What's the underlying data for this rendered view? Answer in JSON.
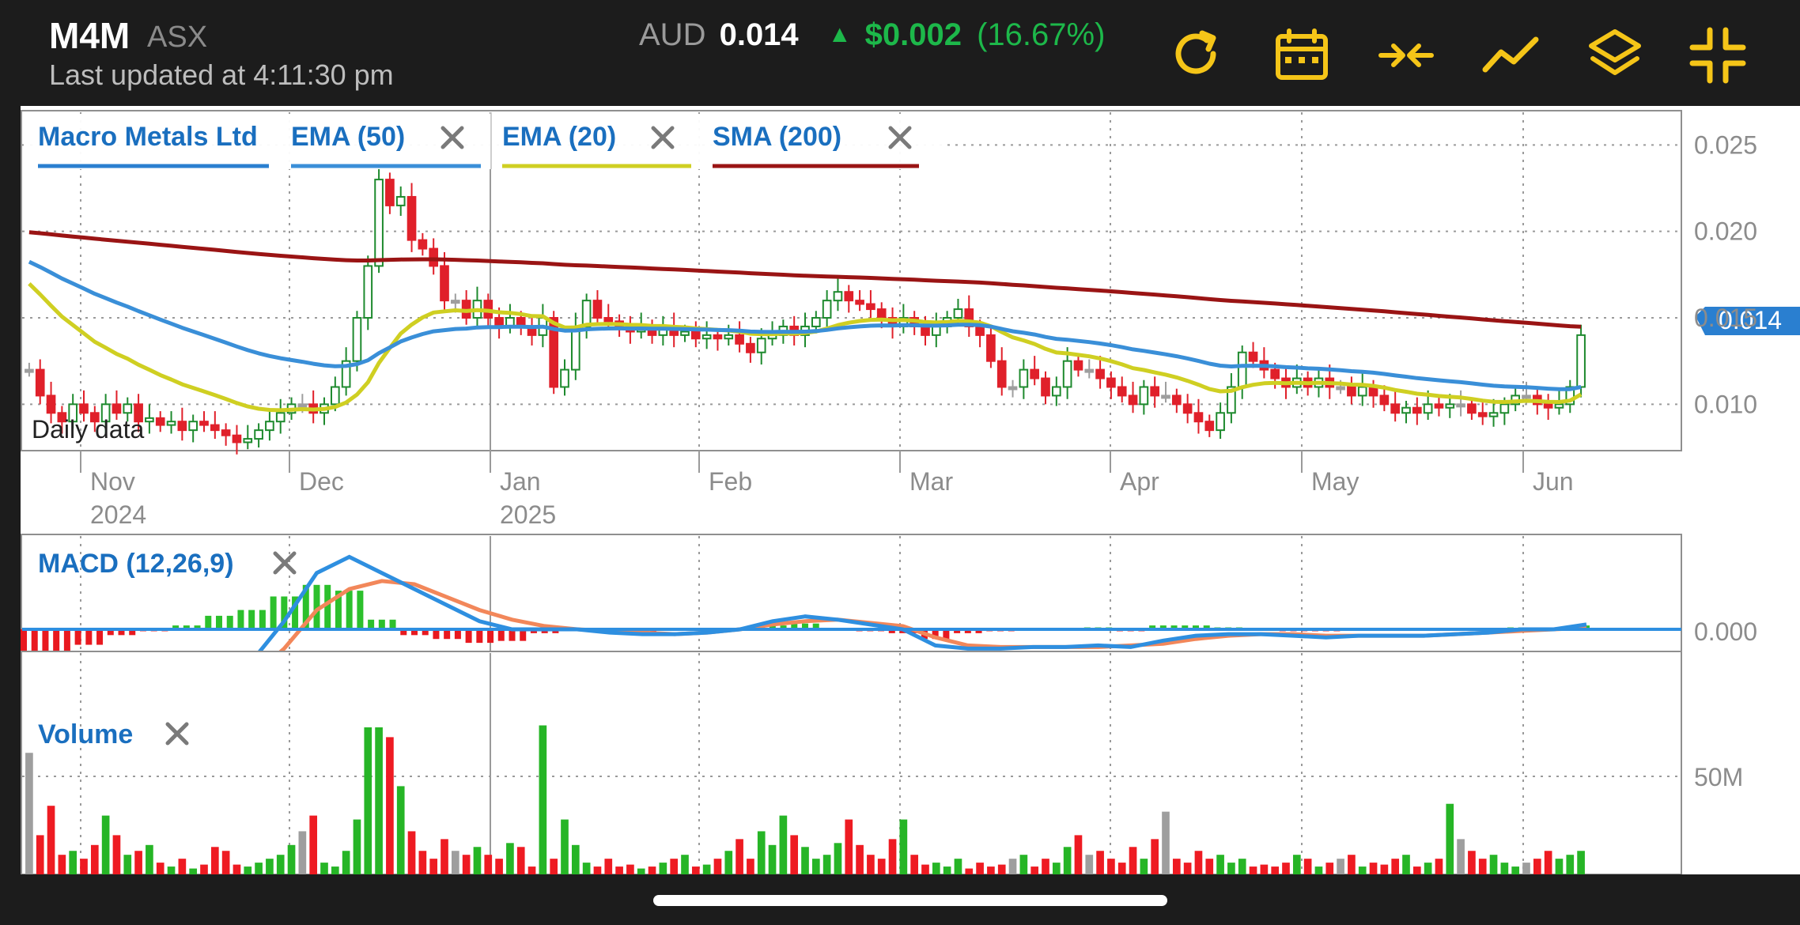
{
  "header": {
    "ticker": "M4M",
    "exchange": "ASX",
    "last_updated": "Last updated at 4:11:30 pm",
    "currency": "AUD",
    "last_price": "0.014",
    "change_abs": "$0.002",
    "change_pct": "(16.67%)",
    "change_direction": "up",
    "toolbar_icons": [
      "refresh-icon",
      "calendar-icon",
      "compress-icon",
      "trend-line-icon",
      "layers-icon",
      "exit-fullscreen-icon"
    ],
    "accent_color": "#f5c518"
  },
  "legend": {
    "main": [
      "Macro Metals Ltd",
      "EMA (50)",
      "EMA (20)",
      "SMA (200)"
    ],
    "macd": "MACD (12,26,9)",
    "volume": "Volume",
    "daily_data": "Daily data"
  },
  "chart_data": [
    {
      "type": "candlestick",
      "title": "Macro Metals Ltd",
      "ylim": [
        0.0075,
        0.0268
      ],
      "y_ticks": [
        "0.025",
        "0.020",
        "0.015",
        "0.010"
      ],
      "x_ticks": [
        {
          "label": "Nov",
          "sub": "2024",
          "pos": 0
        },
        {
          "label": "Dec",
          "sub": "",
          "pos": 1
        },
        {
          "label": "Jan",
          "sub": "2025",
          "pos": 2
        },
        {
          "label": "Feb",
          "sub": "",
          "pos": 3
        },
        {
          "label": "Mar",
          "sub": "",
          "pos": 4
        },
        {
          "label": "Apr",
          "sub": "",
          "pos": 5
        },
        {
          "label": "May",
          "sub": "",
          "pos": 6
        },
        {
          "label": "Jun",
          "sub": "",
          "pos": 7
        }
      ],
      "last_price_label": "0.014",
      "grid": true,
      "colors": {
        "up": "#1e8a2e",
        "down": "#e0202a",
        "flat": "#9e9e9e",
        "ema50": "#3a8fd8",
        "ema20": "#cfcf22",
        "sma200": "#9a1414"
      },
      "close": [
        0.012,
        0.0105,
        0.0095,
        0.009,
        0.01,
        0.0095,
        0.009,
        0.01,
        0.0095,
        0.01,
        0.009,
        0.0092,
        0.0088,
        0.009,
        0.0085,
        0.009,
        0.0088,
        0.0085,
        0.0082,
        0.0078,
        0.008,
        0.0085,
        0.009,
        0.0095,
        0.01,
        0.01,
        0.0095,
        0.01,
        0.011,
        0.0125,
        0.015,
        0.018,
        0.023,
        0.0215,
        0.022,
        0.0195,
        0.019,
        0.018,
        0.016,
        0.016,
        0.015,
        0.016,
        0.015,
        0.0145,
        0.015,
        0.0145,
        0.014,
        0.015,
        0.011,
        0.012,
        0.0145,
        0.016,
        0.015,
        0.0148,
        0.0145,
        0.0142,
        0.0145,
        0.014,
        0.0145,
        0.014,
        0.0142,
        0.0138,
        0.014,
        0.0138,
        0.014,
        0.0135,
        0.013,
        0.0138,
        0.014,
        0.0145,
        0.014,
        0.0145,
        0.015,
        0.016,
        0.0165,
        0.016,
        0.0158,
        0.0155,
        0.015,
        0.0145,
        0.015,
        0.0145,
        0.014,
        0.0145,
        0.015,
        0.0155,
        0.0145,
        0.014,
        0.0125,
        0.011,
        0.011,
        0.012,
        0.0115,
        0.0105,
        0.011,
        0.0125,
        0.012,
        0.012,
        0.0115,
        0.011,
        0.0105,
        0.01,
        0.011,
        0.0105,
        0.0105,
        0.01,
        0.0095,
        0.009,
        0.0085,
        0.0095,
        0.011,
        0.013,
        0.0125,
        0.012,
        0.0115,
        0.011,
        0.0115,
        0.011,
        0.0115,
        0.011,
        0.011,
        0.0105,
        0.011,
        0.0105,
        0.01,
        0.0095,
        0.0098,
        0.0095,
        0.01,
        0.0098,
        0.01,
        0.01,
        0.0095,
        0.0093,
        0.0095,
        0.01,
        0.0105,
        0.0105,
        0.01,
        0.0098,
        0.01,
        0.011,
        0.014
      ]
    },
    {
      "type": "line",
      "title": "MACD (12,26,9)",
      "y_ticks": [
        "0.000"
      ],
      "series": [
        {
          "name": "MACD",
          "color": "#2e8fe0",
          "values": [
            -0.0003,
            -0.00045,
            -0.0005,
            -0.00048,
            -0.00045,
            -0.0004,
            -0.0003,
            -0.0002,
            5e-05,
            0.00035,
            0.00045,
            0.00035,
            0.00025,
            0.00015,
            5e-05,
            0.0,
            0.0,
            0.0,
            -2e-05,
            -3e-05,
            -3e-05,
            -2e-05,
            0.0,
            5e-05,
            8e-05,
            6e-05,
            3e-05,
            0.0,
            -0.0001,
            -0.00012,
            -0.00012,
            -0.00011,
            -0.00011,
            -0.0001,
            -0.00011,
            -7e-05,
            -4e-05,
            -3e-05,
            -3e-05,
            -4e-05,
            -5e-05,
            -4e-05,
            -4e-05,
            -4e-05,
            -3e-05,
            -2e-05,
            0.0,
            0.0,
            3e-05
          ]
        },
        {
          "name": "Signal",
          "color": "#f2875a",
          "values": [
            -0.00015,
            -0.00032,
            -0.00042,
            -0.00045,
            -0.00044,
            -0.00042,
            -0.00037,
            -0.0003,
            -0.00012,
            0.00012,
            0.00025,
            0.0003,
            0.00028,
            0.0002,
            0.00012,
            6e-05,
            2e-05,
            0.0,
            -1e-05,
            -2e-05,
            -3e-05,
            -2e-05,
            0.0,
            3e-05,
            5e-05,
            6e-05,
            4e-05,
            2e-05,
            -5e-05,
            -0.0001,
            -0.00011,
            -0.00011,
            -0.00011,
            -0.00011,
            -0.0001,
            -9e-05,
            -6e-05,
            -4e-05,
            -3e-05,
            -3e-05,
            -4e-05,
            -4e-05,
            -4e-05,
            -4e-05,
            -3e-05,
            -2e-05,
            -1e-05,
            0.0,
            1e-05
          ]
        }
      ]
    },
    {
      "type": "bar",
      "title": "Volume",
      "y_ticks": [
        "50M"
      ],
      "unit": "M",
      "values": [
        62,
        20,
        35,
        10,
        12,
        8,
        15,
        30,
        20,
        10,
        12,
        15,
        6,
        4,
        8,
        3,
        5,
        14,
        12,
        5,
        4,
        6,
        8,
        10,
        15,
        22,
        30,
        6,
        4,
        12,
        28,
        75,
        75,
        70,
        45,
        22,
        12,
        8,
        18,
        12,
        10,
        14,
        10,
        8,
        16,
        14,
        4,
        76,
        8,
        28,
        15,
        6,
        4,
        8,
        4,
        5,
        3,
        4,
        6,
        8,
        10,
        4,
        5,
        8,
        12,
        18,
        8,
        22,
        15,
        30,
        20,
        14,
        8,
        10,
        16,
        28,
        15,
        10,
        8,
        18,
        28,
        10,
        5,
        6,
        4,
        8,
        3,
        6,
        4,
        5,
        8,
        10,
        4,
        8,
        6,
        14,
        20,
        10,
        12,
        8,
        6,
        14,
        8,
        18,
        32,
        8,
        6,
        12,
        8,
        10,
        6,
        8,
        4,
        5,
        4,
        6,
        10,
        8,
        4,
        6,
        8,
        10,
        4,
        6,
        5,
        8,
        10,
        4,
        6,
        8,
        36,
        18,
        12,
        8,
        10,
        6,
        4,
        6,
        8,
        12,
        8,
        10,
        12
      ]
    }
  ]
}
